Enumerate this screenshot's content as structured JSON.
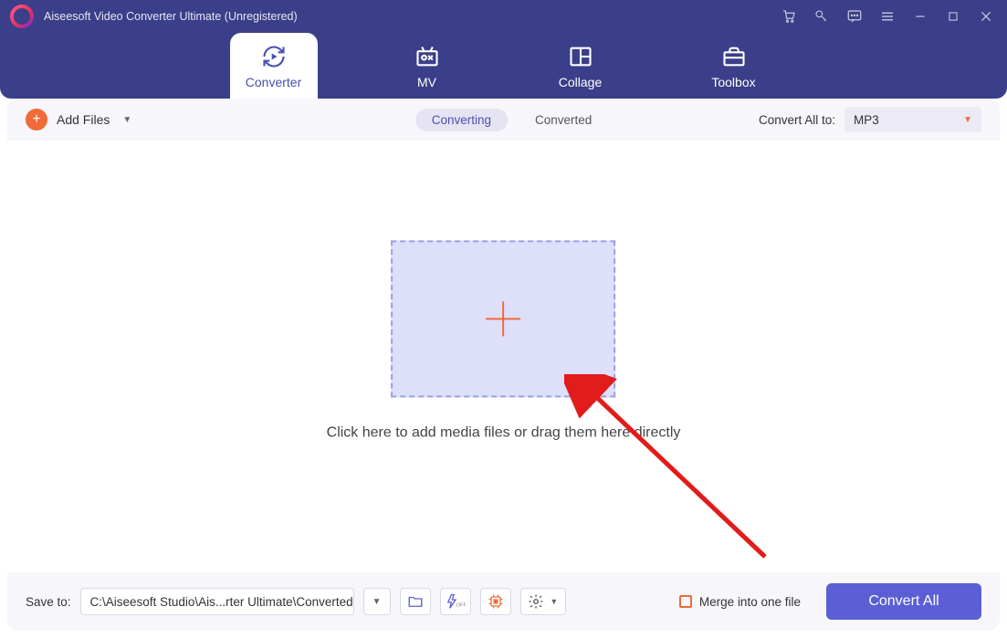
{
  "app": {
    "title": "Aiseesoft Video Converter Ultimate (Unregistered)"
  },
  "tabs": {
    "converter": "Converter",
    "mv": "MV",
    "collage": "Collage",
    "toolbox": "Toolbox"
  },
  "toolbar": {
    "add_files": "Add Files",
    "seg_converting": "Converting",
    "seg_converted": "Converted",
    "convert_all_to": "Convert All to:",
    "format_value": "MP3"
  },
  "dropzone": {
    "text": "Click here to add media files or drag them here directly"
  },
  "footer": {
    "save_to_label": "Save to:",
    "save_path": "C:\\Aiseesoft Studio\\Ais...rter Ultimate\\Converted",
    "merge_label": "Merge into one file",
    "convert_all": "Convert All"
  }
}
